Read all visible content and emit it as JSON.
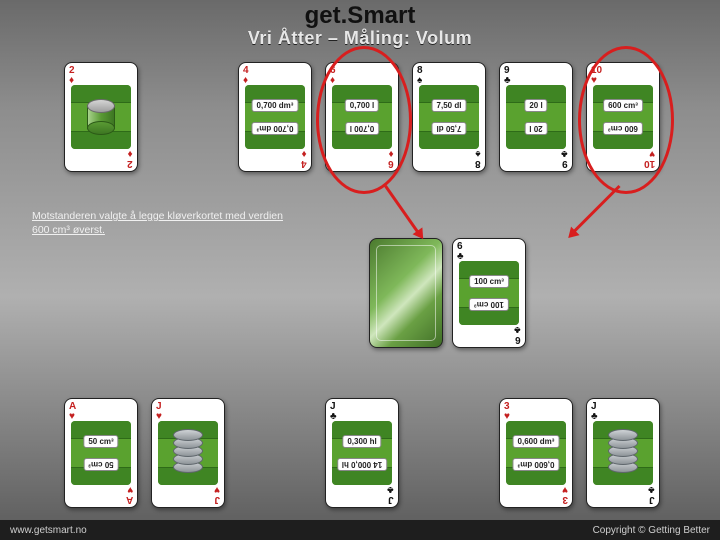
{
  "titles": {
    "main": "get.Smart",
    "sub": "Vri Åtter – Måling: Volum"
  },
  "caption": "Motstanderen valgte å legge kløverkortet med verdien 600 cm³ øverst.",
  "footer": {
    "left": "www.getsmart.no",
    "right": "Copyright © Getting Better"
  },
  "cards": {
    "r1c1": {
      "rank": "2",
      "suit": "♦",
      "color": "red"
    },
    "r1c2": {
      "rank": "4",
      "suit": "♦",
      "color": "red",
      "top": "0,700 dm³",
      "bot": "0,700 dm³"
    },
    "r1c3": {
      "rank": "6",
      "suit": "♦",
      "color": "red",
      "top": "0,700 l",
      "bot": "0,700 l"
    },
    "r1c4": {
      "rank": "8",
      "suit": "♠",
      "color": "black",
      "top": "7,50 dl",
      "bot": "7,50 dl"
    },
    "r1c5": {
      "rank": "9",
      "suit": "♣",
      "color": "black",
      "top": "20 l",
      "bot": "20 l"
    },
    "r1c6": {
      "rank": "10",
      "suit": "♥",
      "color": "red",
      "top": "600 cm³",
      "bot": "600 cm³"
    },
    "mid": {
      "rank": "6",
      "suit": "♣",
      "color": "black",
      "top": "100 cm³",
      "bot": "100 cm³"
    },
    "r3c1": {
      "rank": "A",
      "suit": "♥",
      "color": "red",
      "top": "50 cm³",
      "bot": "50 cm³"
    },
    "r3c2": {
      "rank": "J",
      "suit": "♥",
      "color": "red"
    },
    "r3c3": {
      "rank": "J",
      "suit": "♣",
      "color": "black",
      "top": "0,300 hl",
      "bot": "14 000,0 hl"
    },
    "r3c4": {
      "rank": "3",
      "suit": "♥",
      "color": "red",
      "top": "0,600 dm³",
      "bot": "0,600 dm³"
    },
    "r3c5": {
      "rank": "J",
      "suit": "♣",
      "color": "black"
    }
  }
}
